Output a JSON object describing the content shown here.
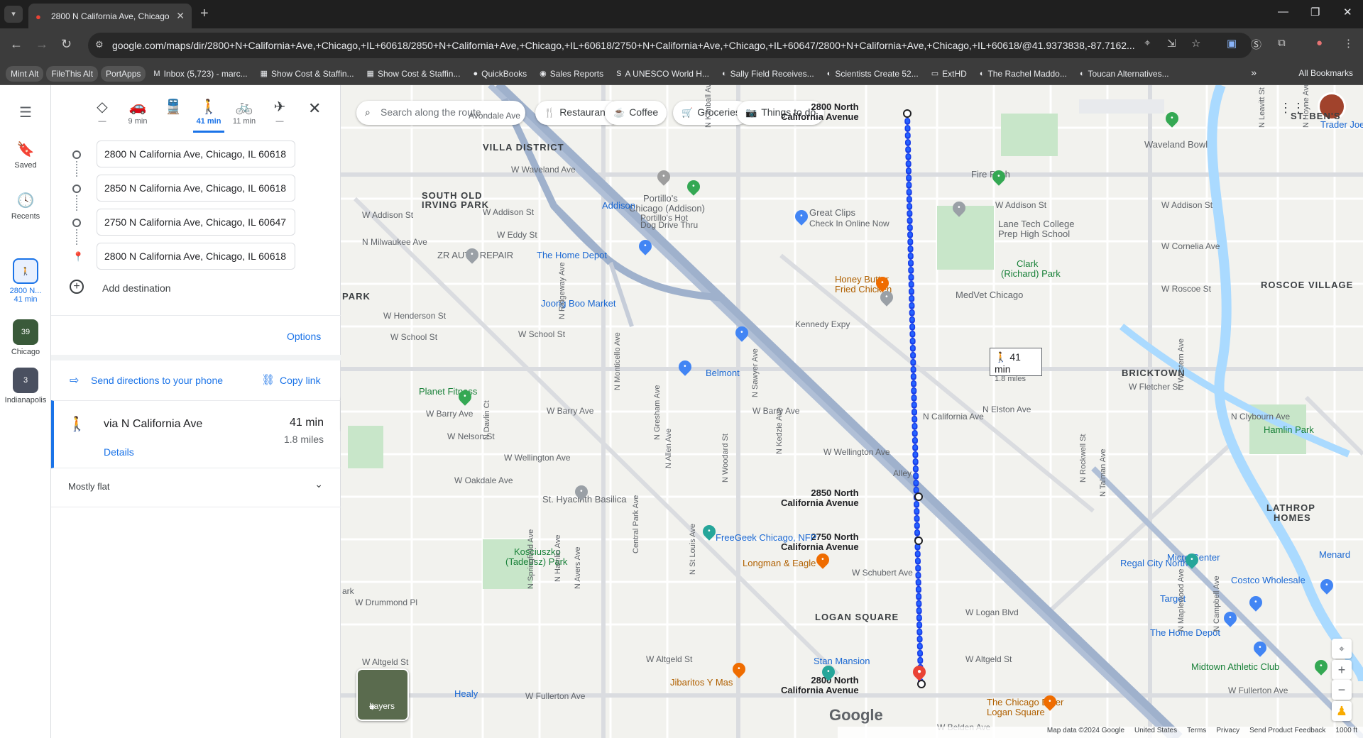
{
  "browser": {
    "tab_title": "2800 N California Ave, Chicago",
    "url": "google.com/maps/dir/2800+N+California+Ave,+Chicago,+IL+60618/2850+N+California+Ave,+Chicago,+IL+60618/2750+N+California+Ave,+Chicago,+IL+60647/2800+N+California+Ave,+Chicago,+IL+60618/@41.9373838,-87.7162...",
    "bookmarks": [
      {
        "label": "Mint Alt",
        "pill": true
      },
      {
        "label": "FileThis Alt",
        "pill": true
      },
      {
        "label": "PortApps",
        "pill": true
      },
      {
        "label": "Inbox (5,723) - marc...",
        "icon": "M"
      },
      {
        "label": "Show Cost & Staffin...",
        "icon": "▦"
      },
      {
        "label": "Show Cost & Staffin...",
        "icon": "▦"
      },
      {
        "label": "QuickBooks",
        "icon": "●"
      },
      {
        "label": "Sales Reports",
        "icon": "◉"
      },
      {
        "label": "A UNESCO World H...",
        "icon": "S"
      },
      {
        "label": "Sally Field Receives...",
        "icon": "◐"
      },
      {
        "label": "Scientists Create 52...",
        "icon": "◐"
      },
      {
        "label": "ExtHD",
        "icon": "▭"
      },
      {
        "label": "The Rachel Maddo...",
        "icon": "◐"
      },
      {
        "label": "Toucan Alternatives...",
        "icon": "◐"
      }
    ],
    "all_bookmarks": "All Bookmarks"
  },
  "rail": {
    "saved": "Saved",
    "recents": "Recents",
    "recent1_line1": "2800 N...",
    "recent1_line2": "41 min",
    "recent2_badge": "39",
    "recent2": "Chicago",
    "recent3_badge": "3",
    "recent3": "Indianapolis"
  },
  "modes": [
    {
      "name": "best",
      "icon": "◇",
      "label": "—"
    },
    {
      "name": "drive",
      "icon": "🚗",
      "label": "9 min"
    },
    {
      "name": "transit",
      "icon": "🚆",
      "label": ""
    },
    {
      "name": "walk",
      "icon": "🚶",
      "label": "41 min",
      "selected": true
    },
    {
      "name": "bike",
      "icon": "🚲",
      "label": "11 min"
    },
    {
      "name": "flight",
      "icon": "✈",
      "label": "—"
    }
  ],
  "stops": [
    "2800 N California Ave, Chicago, IL 60618",
    "2850 N California Ave, Chicago, IL 60618",
    "2750 N California Ave, Chicago, IL 60647",
    "2800 N California Ave, Chicago, IL 60618"
  ],
  "panel": {
    "add_destination": "Add destination",
    "options": "Options",
    "send": "Send directions to your phone",
    "copy": "Copy link",
    "route_via": "via N California Ave",
    "route_time": "41 min",
    "route_dist": "1.8 miles",
    "details": "Details",
    "mostly_flat": "Mostly flat"
  },
  "map": {
    "search_placeholder": "Search along the route",
    "chips": [
      {
        "icon": "🍴",
        "label": "Restaurants"
      },
      {
        "icon": "☕",
        "label": "Coffee"
      },
      {
        "icon": "🛒",
        "label": "Groceries"
      },
      {
        "icon": "📷",
        "label": "Things to do"
      }
    ],
    "walkbox_time": "41 min",
    "walkbox_dist": "1.8 miles",
    "layers": "Layers",
    "google": "Google",
    "attribution": [
      "Map data ©2024 Google",
      "United States",
      "Terms",
      "Privacy",
      "Send Product Feedback",
      "1000 ft"
    ],
    "labels": {
      "villa_district": "VILLA DISTRICT",
      "south_old_irving": "SOUTH OLD",
      "irving_park": "IRVING PARK",
      "park": "PARK",
      "st_bens": "ST. BEN'S",
      "roscoe_village": "ROSCOE VILLAGE",
      "bricktown": "BRICKTOWN",
      "lathrop_homes": "LATHROP",
      "lathrop_homes2": "HOMES",
      "logan_square": "LOGAN SQUARE",
      "w_addison": "W Addison St",
      "w_addison2": "W Addison St",
      "w_addison3": "W Addison St",
      "w_eddy": "W Eddy St",
      "w_henderson": "W Henderson St",
      "w_school": "W School St",
      "w_school2": "W School St",
      "w_barry": "W Barry Ave",
      "w_barry2": "W Barry Ave",
      "w_barry3": "W Barry Ave",
      "w_nelson": "W Nelson St",
      "w_wellington": "W Wellington Ave",
      "w_wellington2": "W Wellington Ave",
      "w_oakdale": "W Oakdale Ave",
      "w_drummond": "W Drummond Pl",
      "w_schubert": "W Schubert Ave",
      "w_logan": "W Logan Blvd",
      "w_altgeld": "W Altgeld St",
      "w_altgeld2": "W Altgeld St",
      "w_altgeld3": "W Altgeld St",
      "w_fullerton": "W Fullerton Ave",
      "w_fullerton2": "W Fullerton Ave",
      "w_belden": "W Belden Ave",
      "w_waveland": "W Waveland Ave",
      "w_cornelia": "W Cornelia Ave",
      "w_roscoe": "W Roscoe St",
      "w_fletcher": "W Fletcher St",
      "n_milwaukee": "N Milwaukee Ave",
      "n_elston": "N Elston Ave",
      "n_clybourn": "N Clybourn Ave",
      "kennedy": "Kennedy Expy",
      "n_california": "N California Ave",
      "avondale": "Avondale Ave",
      "portillos": "Portillo's",
      "portillos2": "Chicago (Addison)",
      "portillos3": "Portillo's Hot",
      "portillos4": "Dog Drive Thru",
      "great_clips": "Great Clips",
      "great_clips2": "Check In Online Now",
      "zr_auto": "ZR AUTO REPAIR",
      "home_depot": "The Home Depot",
      "home_depot2": "The Home Depot",
      "honey_butter": "Honey Butter",
      "honey_butter2": "Fried Chicken",
      "joong_boo": "Joong Boo Market",
      "medvet": "MedVet Chicago",
      "lane_tech": "Lane Tech College",
      "lane_tech2": "Prep High School",
      "clark_park": "Clark",
      "clark_park2": "(Richard) Park",
      "waveland_bowl": "Waveland Bowl",
      "fire_pitch": "Fire Pitch",
      "addison_station": "Addison",
      "belmont": "Belmont",
      "planet_fitness": "Planet Fitness",
      "st_hyacinth": "St. Hyacinth Basilica",
      "freegeek": "FreeGeek Chicago, NFP",
      "longman": "Longman & Eagle",
      "kosciuszko": "Kosciuszko",
      "kosciuszko2": "(Tadeusz) Park",
      "regal": "Regal City North",
      "micro_center": "Micro Center",
      "costco": "Costco Wholesale",
      "target": "Target",
      "midtown": "Midtown Athletic Club",
      "hamlin_park": "Hamlin Park",
      "menard": "Menard",
      "jibaritos": "Jibaritos Y Mas",
      "stan_mansion": "Stan Mansion",
      "healy": "Healy",
      "chicago_diner": "The Chicago Diner",
      "chicago_diner2": "Logan Square",
      "trader_joes": "Trader Joe's",
      "ark": "ark",
      "stop1a": "2800 North",
      "stop1b": "California Avenue",
      "stop2a": "2850 North",
      "stop2b": "California Avenue",
      "stop3a": "2750 North",
      "stop3b": "California Avenue",
      "stop4a": "2800 North",
      "stop4b": "California Avenue",
      "n_kimball": "N Kimball Ave",
      "n_kedzie": "N Kedzie Ave",
      "n_sawyer": "N Sawyer Ave",
      "n_ridgeway": "N Ridgeway Ave",
      "n_monticello": "N Monticello Ave",
      "central_park": "Central Park Ave",
      "n_hamlin": "N Hamlin Ave",
      "n_western": "N Western Ave",
      "n_rockwell": "N Rockwell St",
      "n_talman": "N Talman Ave",
      "n_campbell": "N Campbell Ave",
      "n_maplewood": "N Maplewood Ave",
      "n_leavitt": "N Leavitt St",
      "n_hoyne": "N Hoyne Ave",
      "n_st_louis": "N St Louis Ave",
      "n_springfield": "N Springfield Ave",
      "n_avers": "N Avers Ave",
      "n_allen": "N Allen Ave",
      "n_woodard": "N Woodard St",
      "n_davlin": "N Davlin Ct",
      "n_gresham": "N Gresham Ave",
      "alley": "Alley"
    }
  }
}
